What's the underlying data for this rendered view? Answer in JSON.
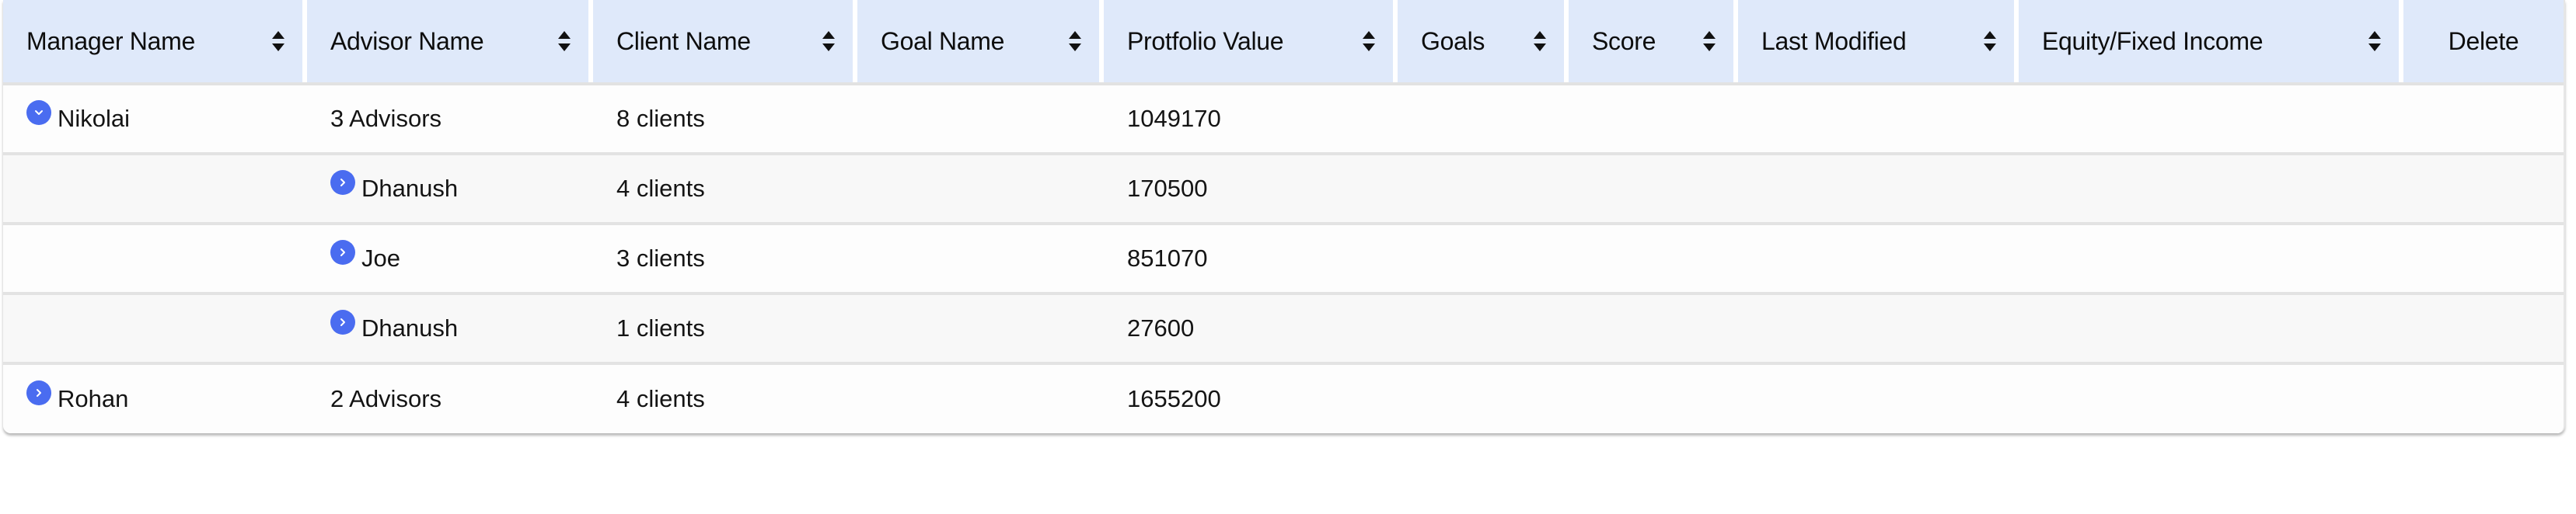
{
  "table": {
    "columns": [
      {
        "label": "Manager Name",
        "sortable": true
      },
      {
        "label": "Advisor Name",
        "sortable": true
      },
      {
        "label": "Client Name",
        "sortable": true
      },
      {
        "label": "Goal Name",
        "sortable": true
      },
      {
        "label": "Protfolio Value",
        "sortable": true
      },
      {
        "label": "Goals",
        "sortable": true
      },
      {
        "label": "Score",
        "sortable": true
      },
      {
        "label": "Last Modified",
        "sortable": true
      },
      {
        "label": "Equity/Fixed Income",
        "sortable": true
      },
      {
        "label": "Delete",
        "sortable": false
      }
    ],
    "rows": [
      {
        "level": "manager",
        "expanded": true,
        "expander_icon": "chevron-down-icon",
        "manager": "Nikolai",
        "advisor": "3 Advisors",
        "client": "8 clients",
        "goal_name": "",
        "portfolio_value": "1049170",
        "goals": "",
        "score": "",
        "last_modified": "",
        "equity_fixed_income": "",
        "delete": ""
      },
      {
        "level": "advisor",
        "expanded": false,
        "expander_icon": "chevron-right-icon",
        "manager": "",
        "advisor": "Dhanush",
        "client": "4 clients",
        "goal_name": "",
        "portfolio_value": "170500",
        "goals": "",
        "score": "",
        "last_modified": "",
        "equity_fixed_income": "",
        "delete": ""
      },
      {
        "level": "advisor",
        "expanded": false,
        "expander_icon": "chevron-right-icon",
        "manager": "",
        "advisor": "Joe",
        "client": "3 clients",
        "goal_name": "",
        "portfolio_value": "851070",
        "goals": "",
        "score": "",
        "last_modified": "",
        "equity_fixed_income": "",
        "delete": ""
      },
      {
        "level": "advisor",
        "expanded": false,
        "expander_icon": "chevron-right-icon",
        "manager": "",
        "advisor": "Dhanush",
        "client": "1 clients",
        "goal_name": "",
        "portfolio_value": "27600",
        "goals": "",
        "score": "",
        "last_modified": "",
        "equity_fixed_income": "",
        "delete": ""
      },
      {
        "level": "manager",
        "expanded": false,
        "expander_icon": "chevron-right-icon",
        "manager": "Rohan",
        "advisor": "2 Advisors",
        "client": "4 clients",
        "goal_name": "",
        "portfolio_value": "1655200",
        "goals": "",
        "score": "",
        "last_modified": "",
        "equity_fixed_income": "",
        "delete": ""
      }
    ]
  },
  "colors": {
    "header_bg": "#dfe9fa",
    "expander_bg": "#4a6cf0",
    "row_alt_bg": "#f8f8f8",
    "divider": "#e3e3e3"
  }
}
